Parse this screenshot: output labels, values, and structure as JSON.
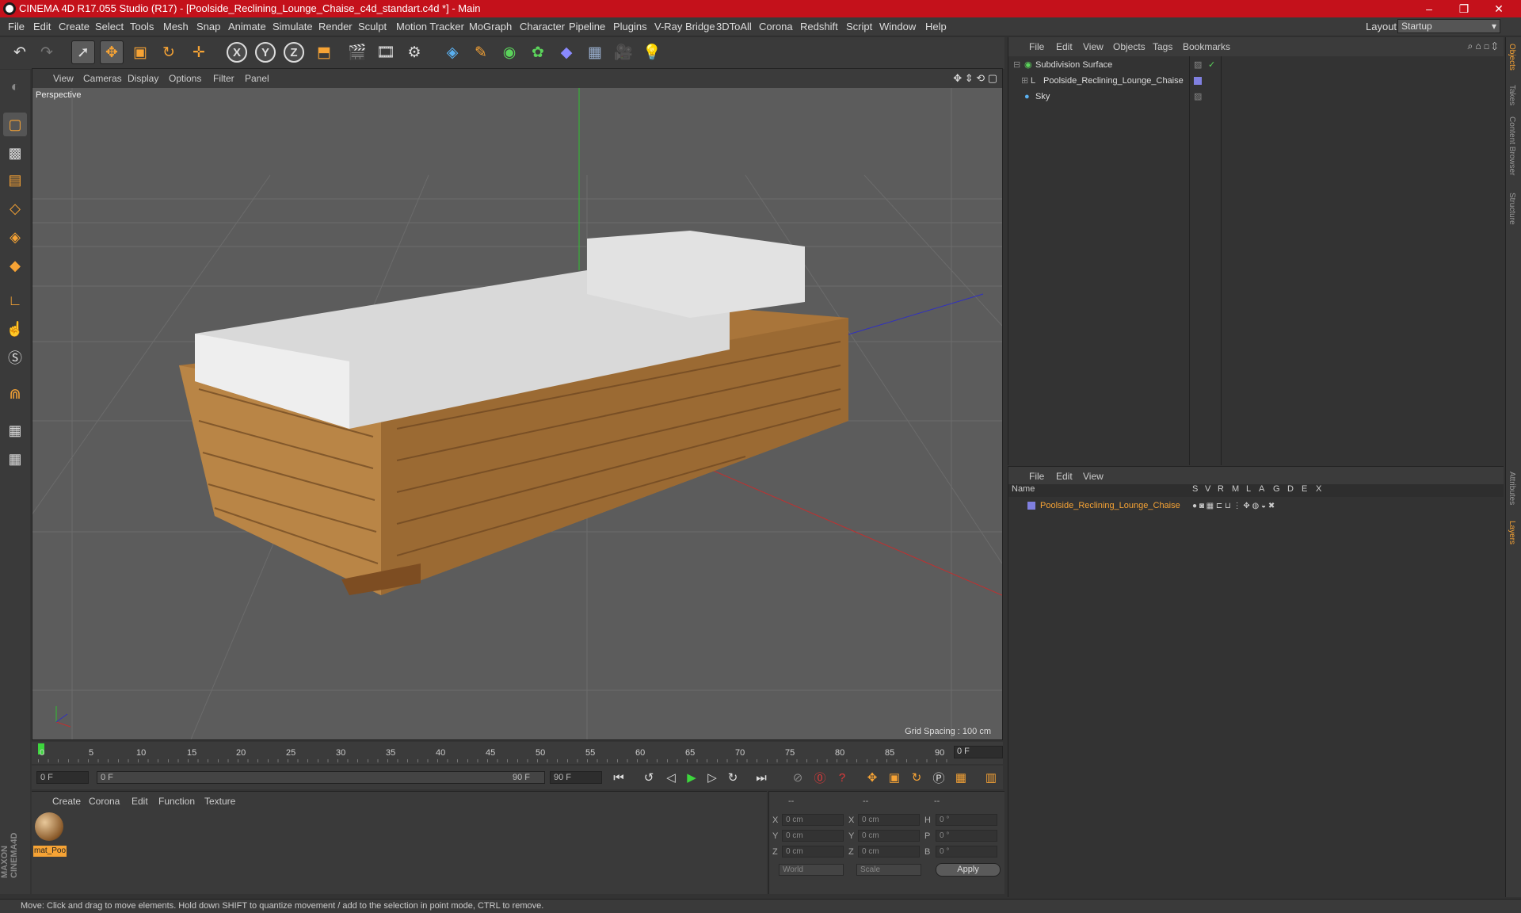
{
  "window": {
    "title": "CINEMA 4D R17.055 Studio (R17) - [Poolside_Reclining_Lounge_Chaise_c4d_standart.c4d *] - Main",
    "controls": [
      "–",
      "❐",
      "✕"
    ]
  },
  "menu": [
    "File",
    "Edit",
    "Create",
    "Select",
    "Tools",
    "Mesh",
    "Snap",
    "Animate",
    "Simulate",
    "Render",
    "Sculpt",
    "Motion Tracker",
    "MoGraph",
    "Character",
    "Pipeline",
    "Plugins",
    "V-Ray Bridge",
    "3DToAll",
    "Corona",
    "Redshift",
    "Script",
    "Window",
    "Help"
  ],
  "layout": {
    "label": "Layout:",
    "value": "Startup"
  },
  "toolbar": {
    "icons": [
      "undo-icon",
      "redo-icon",
      "select-icon",
      "move-icon",
      "scale-icon",
      "rotate-icon",
      "transform-icon",
      "x-axis-icon",
      "y-axis-icon",
      "z-axis-icon",
      "coord-system-icon",
      "render-view-icon",
      "render-picture-icon",
      "edit-render-settings-icon",
      "cube-icon",
      "pen-icon",
      "subdivision-icon",
      "array-icon",
      "deformer-icon",
      "floor-icon",
      "camera-icon",
      "light-icon"
    ],
    "xyz": [
      "X",
      "Y",
      "Z"
    ]
  },
  "viewport": {
    "menu": [
      "View",
      "Cameras",
      "Display",
      "Options",
      "Filter",
      "Panel"
    ],
    "label": "Perspective",
    "grid_spacing": "Grid Spacing : 100 cm"
  },
  "timeline": {
    "ticks": [
      "0",
      "5",
      "10",
      "15",
      "20",
      "25",
      "30",
      "35",
      "40",
      "45",
      "50",
      "55",
      "60",
      "65",
      "70",
      "75",
      "80",
      "85",
      "90"
    ],
    "current_frame": "0 F"
  },
  "playback": {
    "start": "0 F",
    "range_start": "0 F",
    "range_end": "90 F",
    "end": "90 F"
  },
  "materials": {
    "menu": [
      "Create",
      "Corona",
      "Edit",
      "Function",
      "Texture"
    ],
    "items": [
      {
        "name": "mat_Poo"
      }
    ]
  },
  "coords": {
    "headers": [
      "--",
      "--",
      "--"
    ],
    "rows": [
      {
        "a": "X",
        "av": "0 cm",
        "b": "X",
        "bv": "0 cm",
        "c": "H",
        "cv": "0 °"
      },
      {
        "a": "Y",
        "av": "0 cm",
        "b": "Y",
        "bv": "0 cm",
        "c": "P",
        "cv": "0 °"
      },
      {
        "a": "Z",
        "av": "0 cm",
        "b": "Z",
        "bv": "0 cm",
        "c": "B",
        "cv": "0 °"
      }
    ],
    "mode1": "World",
    "mode2": "Scale",
    "apply": "Apply"
  },
  "objects": {
    "menu": [
      "File",
      "Edit",
      "View",
      "Objects",
      "Tags",
      "Bookmarks"
    ],
    "items": [
      {
        "name": "Subdivision Surface"
      },
      {
        "name": "Poolside_Reclining_Lounge_Chaise"
      },
      {
        "name": "Sky"
      }
    ]
  },
  "layers": {
    "menu": [
      "File",
      "Edit",
      "View"
    ],
    "columns": [
      "Name",
      "S",
      "V",
      "R",
      "M",
      "L",
      "A",
      "G",
      "D",
      "E",
      "X"
    ],
    "items": [
      {
        "name": "Poolside_Reclining_Lounge_Chaise"
      }
    ]
  },
  "right_tabs": [
    "Objects",
    "Takes",
    "Content Browser",
    "Structure",
    "Attributes",
    "Layers"
  ],
  "status": "Move: Click and drag to move elements. Hold down SHIFT to quantize movement / add to the selection in point mode, CTRL to remove.",
  "colors": {
    "accent": "#f6a335",
    "titlebar": "#c4111b",
    "layer": "#8080e0"
  }
}
